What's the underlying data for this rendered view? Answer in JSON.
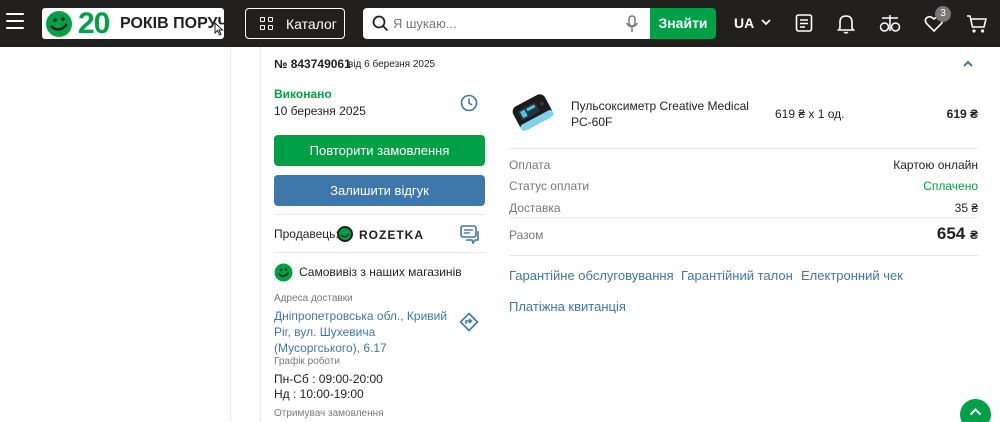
{
  "header": {
    "logo_number": "20",
    "logo_text": "РОКІВ ПОРУЧ",
    "catalog_label": "Каталог",
    "search_placeholder": "Я шукаю...",
    "find_label": "Знайти",
    "lang_label": "UA",
    "wishlist_count": "3",
    "icons": [
      "menu-icon",
      "catalog-icon",
      "search-icon",
      "microphone-icon",
      "chevron-down-icon",
      "orders-icon",
      "bell-icon",
      "compare-icon",
      "heart-icon",
      "cart-icon"
    ]
  },
  "order": {
    "number": "№ 843749061",
    "date": "від 6 березня 2025",
    "status": "Виконано",
    "status_date": "10 березня 2025",
    "repeat_label": "Повторити замовлення",
    "review_label": "Залишити відгук",
    "seller_label": "Продавець:",
    "seller_name": "ROZETKA",
    "pickup_label": "Самовивіз з наших магазинів",
    "address_label": "Адреса доставки",
    "address": "Дніпропетровська обл., Кривий Ріг, вул. Шухевича (Мусоргського), 6.17",
    "schedule_label": "Графік роботи",
    "schedule_weekdays": "Пн-Сб : 09:00-20:00",
    "schedule_sunday": "Нд : 10:00-19:00",
    "recipient_label": "Отримувач замовлення"
  },
  "product": {
    "name": "Пульсоксиметр Creative Medical PC-60F",
    "qty": "619 ₴ x 1 од.",
    "total": "619 ₴"
  },
  "summary": {
    "payment_label": "Оплата",
    "payment_value": "Картою онлайн",
    "payment_status_label": "Статус оплати",
    "payment_status_value": "Сплачено",
    "delivery_label": "Доставка",
    "delivery_value": "35 ₴",
    "total_label": "Разом",
    "total_amount": "654",
    "total_currency": "₴"
  },
  "links": {
    "warranty_service": "Гарантійне обслуговування",
    "warranty_card": "Гарантійний талон",
    "e_receipt": "Електронний чек",
    "payment_receipt": "Платіжна квитанція"
  },
  "colors": {
    "header_bg": "#221f1f",
    "brand_green": "#00a046",
    "link_blue": "#3e77aa",
    "button_blue": "#3e77aa",
    "muted_text": "#797878"
  }
}
